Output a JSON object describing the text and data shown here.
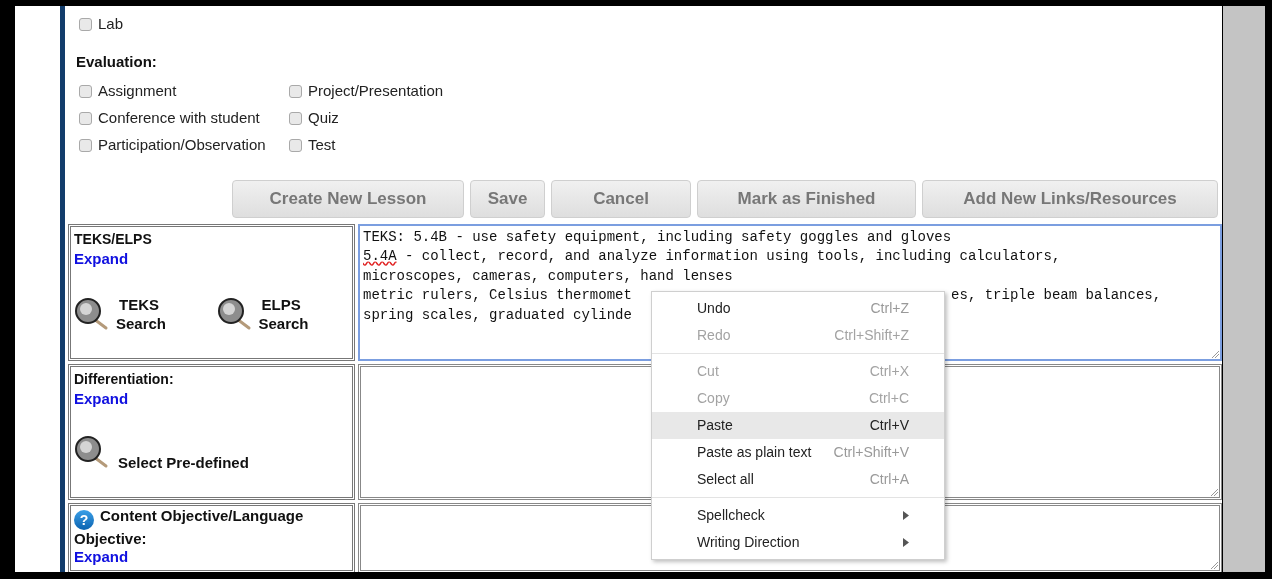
{
  "activities_tail": [
    {
      "label": "Lab",
      "checked": false
    }
  ],
  "evaluation": {
    "title": "Evaluation:",
    "options": [
      {
        "label": "Assignment",
        "checked": false
      },
      {
        "label": "Project/Presentation",
        "checked": false
      },
      {
        "label": "Conference with student",
        "checked": false
      },
      {
        "label": "Quiz",
        "checked": false
      },
      {
        "label": "Participation/Observation",
        "checked": false
      },
      {
        "label": "Test",
        "checked": false
      }
    ]
  },
  "buttons": [
    "Create New Lesson",
    "Save",
    "Cancel",
    "Mark as Finished",
    "Add New Links/Resources"
  ],
  "rows": [
    {
      "kind": "search_pair",
      "label": "TEKS/ELPS",
      "expand": "Expand",
      "focused": true,
      "searches": [
        {
          "name": "TEKS",
          "action": "Search"
        },
        {
          "name": "ELPS",
          "action": "Search"
        }
      ],
      "lines": [
        {
          "segments": [
            {
              "text": "TEKS: 5.4B - use safety equipment, including safety goggles and gloves",
              "flagged": false
            }
          ]
        },
        {
          "segments": [
            {
              "text": "5.4A",
              "flagged": true
            },
            {
              "text": " - collect, record, and analyze information using tools, including calculators,",
              "flagged": false
            }
          ]
        },
        {
          "segments": [
            {
              "text": "microscopes, cameras, computers, hand lenses",
              "flagged": false
            }
          ]
        },
        {
          "segments": [
            {
              "text": "metric rulers, Celsius thermomet",
              "flagged": false
            }
          ],
          "after_menu": "es, triple beam balances,"
        },
        {
          "segments": [
            {
              "text": "spring scales, graduated cylinde",
              "flagged": false
            }
          ]
        }
      ]
    },
    {
      "kind": "predefined",
      "label": "Differentiation:",
      "expand": "Expand",
      "focused": false,
      "action": "Select Pre-defined"
    },
    {
      "kind": "help",
      "label": "Content Objective/Language Objective:",
      "expand": "Expand",
      "focused": false,
      "help_icon": "?"
    }
  ],
  "context_menu": [
    {
      "kind": "item",
      "label": "Undo",
      "shortcut": "Ctrl+Z",
      "disabled": false,
      "selected": false
    },
    {
      "kind": "item",
      "label": "Redo",
      "shortcut": "Ctrl+Shift+Z",
      "disabled": true,
      "selected": false
    },
    {
      "kind": "separator"
    },
    {
      "kind": "item",
      "label": "Cut",
      "shortcut": "Ctrl+X",
      "disabled": true,
      "selected": false
    },
    {
      "kind": "item",
      "label": "Copy",
      "shortcut": "Ctrl+C",
      "disabled": true,
      "selected": false
    },
    {
      "kind": "item",
      "label": "Paste",
      "shortcut": "Ctrl+V",
      "disabled": false,
      "selected": true
    },
    {
      "kind": "item",
      "label": "Paste as plain text",
      "shortcut": "Ctrl+Shift+V",
      "disabled": false,
      "selected": false
    },
    {
      "kind": "item",
      "label": "Select all",
      "shortcut": "Ctrl+A",
      "disabled": false,
      "selected": false
    },
    {
      "kind": "separator"
    },
    {
      "kind": "submenu",
      "label": "Spellcheck",
      "disabled": false,
      "selected": false
    },
    {
      "kind": "submenu",
      "label": "Writing Direction",
      "disabled": false,
      "selected": false
    }
  ]
}
